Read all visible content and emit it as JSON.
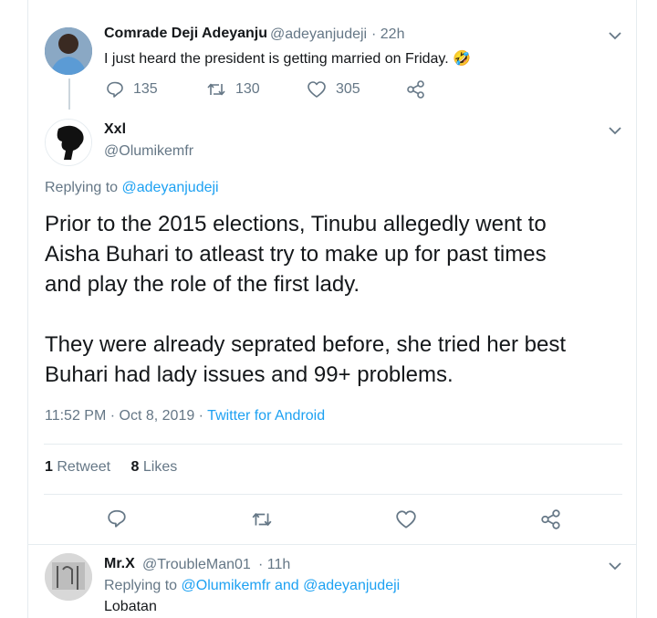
{
  "tweet1": {
    "name": "Comrade Deji Adeyanju",
    "handle": "@adeyanjudeji",
    "time": "· 22h",
    "text": "I just heard the president is getting married on Friday.",
    "emoji": "🤣",
    "replies": "135",
    "retweets": "130",
    "likes": "305"
  },
  "main": {
    "name": "Xxl",
    "handle": "@Olumikemfr",
    "replying_prefix": "Replying to",
    "replying_to": "@adeyanjudeji",
    "lines": [
      "Prior to the 2015 elections, Tinubu allegedly went to",
      "Aisha Buhari to atleast try to make up for past times",
      "and play the role of the first lady.",
      "They were already seprated before, she tried her best",
      "Buhari had lady issues and 99+ problems."
    ],
    "timestamp": "11:52 PM · Oct 8, 2019 ·",
    "source": "Twitter for Android",
    "retweet_count": "1",
    "retweet_label": "Retweet",
    "like_count": "8",
    "like_label": "Likes"
  },
  "reply": {
    "name": "Mr.X",
    "handle": "@TroubleMan01",
    "time": "· 11h",
    "replying_prefix": "Replying to",
    "replying_to": "@Olumikemfr and @adeyanjudeji",
    "text": "Lobatan"
  },
  "colors": {
    "accent": "#1da1f2",
    "muted": "#657786",
    "border": "#e6ecf0"
  },
  "icons": [
    "reply-icon",
    "retweet-icon",
    "like-icon",
    "share-icon",
    "chevron-down-icon"
  ]
}
